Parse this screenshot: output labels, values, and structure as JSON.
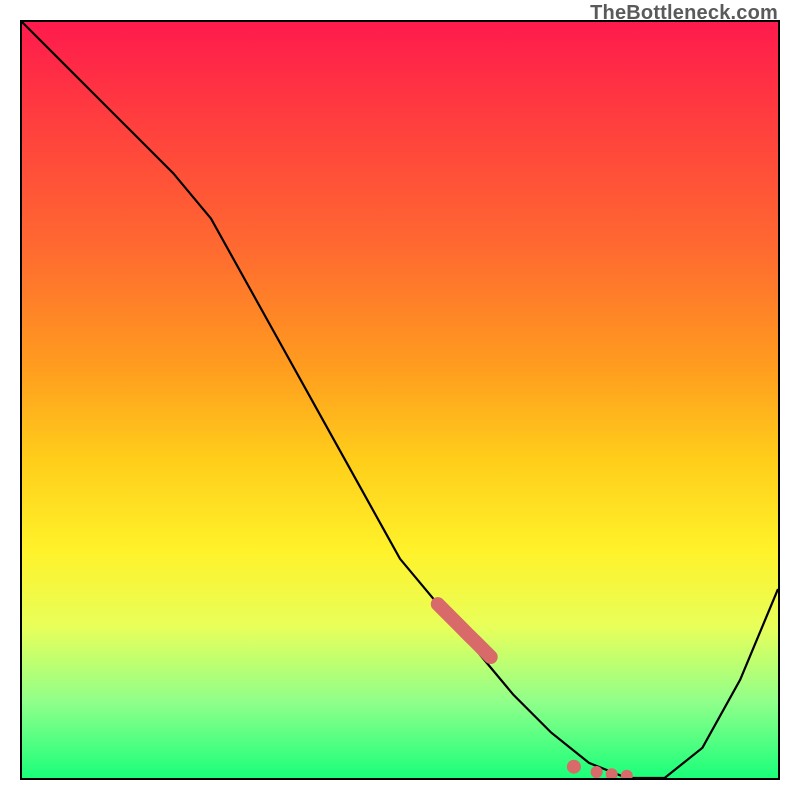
{
  "watermark": "TheBottleneck.com",
  "chart_data": {
    "type": "line",
    "title": "",
    "xlabel": "",
    "ylabel": "",
    "xlim": [
      0,
      100
    ],
    "ylim": [
      0,
      100
    ],
    "grid": false,
    "legend": false,
    "series": [
      {
        "name": "curve",
        "x": [
          0,
          5,
          10,
          15,
          20,
          25,
          30,
          35,
          40,
          45,
          50,
          55,
          60,
          65,
          70,
          75,
          80,
          85,
          90,
          95,
          100
        ],
        "y": [
          100,
          95,
          90,
          85,
          80,
          74,
          65,
          56,
          47,
          38,
          29,
          23,
          17,
          11,
          6,
          2,
          0,
          0,
          4,
          13,
          25
        ],
        "color": "#000000"
      },
      {
        "name": "highlight-segment",
        "x": [
          55,
          56,
          57,
          58,
          59,
          60,
          61,
          62
        ],
        "y": [
          23,
          22,
          21,
          20,
          19,
          18,
          17,
          16
        ],
        "color": "#d96a6a",
        "style": "thick-stroke"
      },
      {
        "name": "highlight-dots",
        "x": [
          73,
          76,
          78,
          80
        ],
        "y": [
          1.5,
          0.8,
          0.5,
          0.3
        ],
        "color": "#d96a6a",
        "style": "dots"
      }
    ],
    "background": {
      "type": "vertical-gradient",
      "stops": [
        {
          "pos": 0.0,
          "color": "#ff1a4d"
        },
        {
          "pos": 0.3,
          "color": "#ff6a30"
        },
        {
          "pos": 0.58,
          "color": "#ffce1a"
        },
        {
          "pos": 0.8,
          "color": "#e8ff5a"
        },
        {
          "pos": 1.0,
          "color": "#1aff7a"
        }
      ]
    }
  }
}
